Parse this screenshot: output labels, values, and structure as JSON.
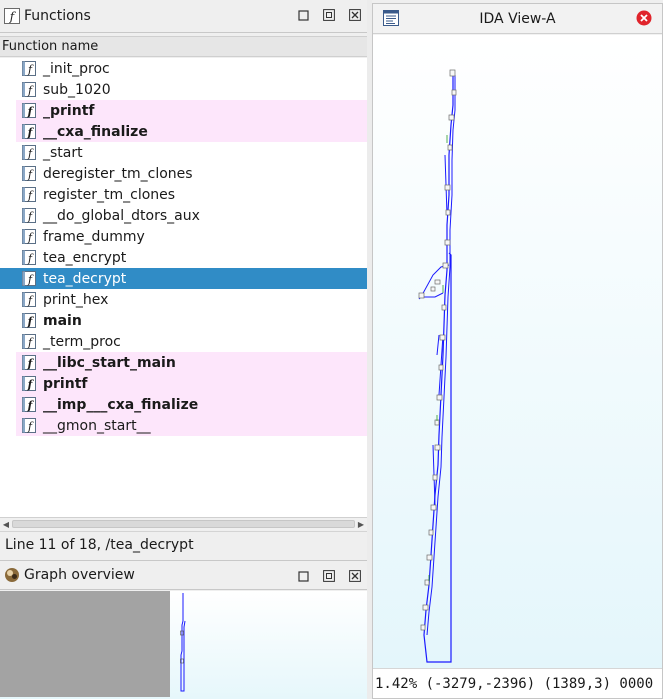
{
  "functions_panel": {
    "title": "Functions",
    "column_header": "Function name",
    "items": [
      {
        "name": "_init_proc",
        "lib": false,
        "bold": false,
        "selected": false
      },
      {
        "name": "sub_1020",
        "lib": false,
        "bold": false,
        "selected": false
      },
      {
        "name": "_printf",
        "lib": true,
        "bold": true,
        "selected": false
      },
      {
        "name": "__cxa_finalize",
        "lib": true,
        "bold": true,
        "selected": false
      },
      {
        "name": "_start",
        "lib": false,
        "bold": false,
        "selected": false
      },
      {
        "name": "deregister_tm_clones",
        "lib": false,
        "bold": false,
        "selected": false
      },
      {
        "name": "register_tm_clones",
        "lib": false,
        "bold": false,
        "selected": false
      },
      {
        "name": "__do_global_dtors_aux",
        "lib": false,
        "bold": false,
        "selected": false
      },
      {
        "name": "frame_dummy",
        "lib": false,
        "bold": false,
        "selected": false
      },
      {
        "name": "tea_encrypt",
        "lib": false,
        "bold": false,
        "selected": false
      },
      {
        "name": "tea_decrypt",
        "lib": false,
        "bold": false,
        "selected": true
      },
      {
        "name": "print_hex",
        "lib": false,
        "bold": false,
        "selected": false
      },
      {
        "name": "main",
        "lib": false,
        "bold": true,
        "selected": false
      },
      {
        "name": "_term_proc",
        "lib": false,
        "bold": false,
        "selected": false
      },
      {
        "name": "__libc_start_main",
        "lib": true,
        "bold": true,
        "selected": false
      },
      {
        "name": "printf",
        "lib": true,
        "bold": true,
        "selected": false
      },
      {
        "name": "__imp___cxa_finalize",
        "lib": true,
        "bold": true,
        "selected": false
      },
      {
        "name": "__gmon_start__",
        "lib": true,
        "bold": false,
        "selected": false
      }
    ],
    "status": "Line 11 of 18, /tea_decrypt"
  },
  "graph_overview": {
    "title": "Graph overview"
  },
  "ida_view": {
    "title": "IDA View-A",
    "status": "1.42% (-3279,-2396) (1389,3) 0000"
  },
  "colors": {
    "selected_row": "#308cc6",
    "library_row": "#fde6fb",
    "graph_edge": "#1a1aff",
    "close_button": "#e0242b"
  }
}
